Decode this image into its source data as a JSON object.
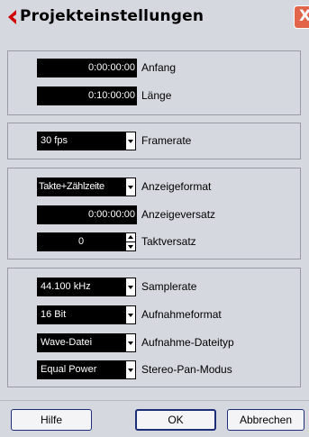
{
  "window": {
    "title": "Projekteinstellungen",
    "close_glyph": "X"
  },
  "time": {
    "start_value": "0:00:00:00",
    "start_label": "Anfang",
    "length_value": "0:10:00:00",
    "length_label": "Länge"
  },
  "framerate": {
    "value": "30 fps",
    "label": "Framerate"
  },
  "display": {
    "format_value": "Takte+Zählzeite",
    "format_label": "Anzeigeformat",
    "offset_value": "0:00:00:00",
    "offset_label": "Anzeigeversatz",
    "bar_offset_value": "0",
    "bar_offset_label": "Taktversatz"
  },
  "audio": {
    "samplerate_value": "44.100 kHz",
    "samplerate_label": "Samplerate",
    "format_value": "16 Bit",
    "format_label": "Aufnahmeformat",
    "filetype_value": "Wave-Datei",
    "filetype_label": "Aufnahme-Dateityp",
    "panmode_value": "Equal Power",
    "panmode_label": "Stereo-Pan-Modus"
  },
  "buttons": {
    "help": "Hilfe",
    "ok": "OK",
    "cancel": "Abbrechen"
  },
  "colors": {
    "background": "#d6d8e0",
    "field": "#000000",
    "close": "#e2654a",
    "accent": "#cc0000"
  }
}
